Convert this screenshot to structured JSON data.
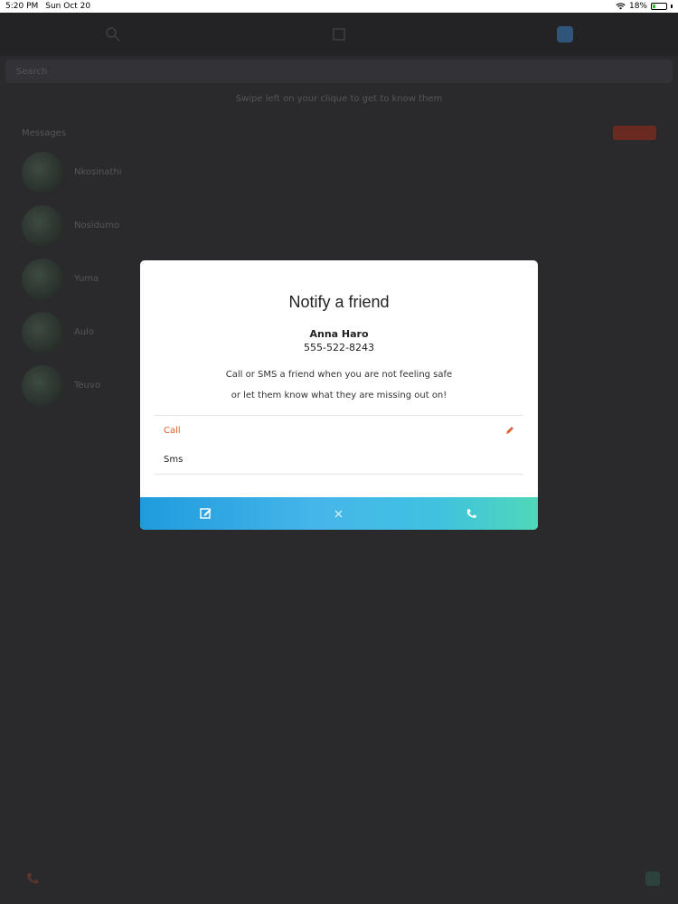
{
  "status_bar": {
    "time": "5:20 PM",
    "date": "Sun Oct 20",
    "battery": "18%",
    "battery_level": 0.18
  },
  "background": {
    "search_placeholder": "Search",
    "hint": "Swipe left on your clique to get to know them",
    "list_header": "Messages",
    "cliques": [
      {
        "name": "Nkosinathi"
      },
      {
        "name": "Nosidumo"
      },
      {
        "name": "Yuma"
      },
      {
        "name": "Aulo"
      },
      {
        "name": "Teuvo"
      }
    ]
  },
  "modal": {
    "title": "Notify a friend",
    "contact_name": "Anna Haro",
    "contact_phone": "555-522-8243",
    "description_line1": "Call or SMS a friend when you are not feeling safe",
    "description_line2": "or let them know what they are missing out on!",
    "options": [
      {
        "label": "Call",
        "selected": true
      },
      {
        "label": "Sms",
        "selected": false
      }
    ],
    "actions": {
      "edit_icon": "edit-note-icon",
      "close_icon": "close-icon",
      "call_icon": "phone-icon"
    }
  },
  "colors": {
    "accent_orange": "#e0622a",
    "gradient_start": "#1f9bdc",
    "gradient_end": "#4fd8b8"
  }
}
